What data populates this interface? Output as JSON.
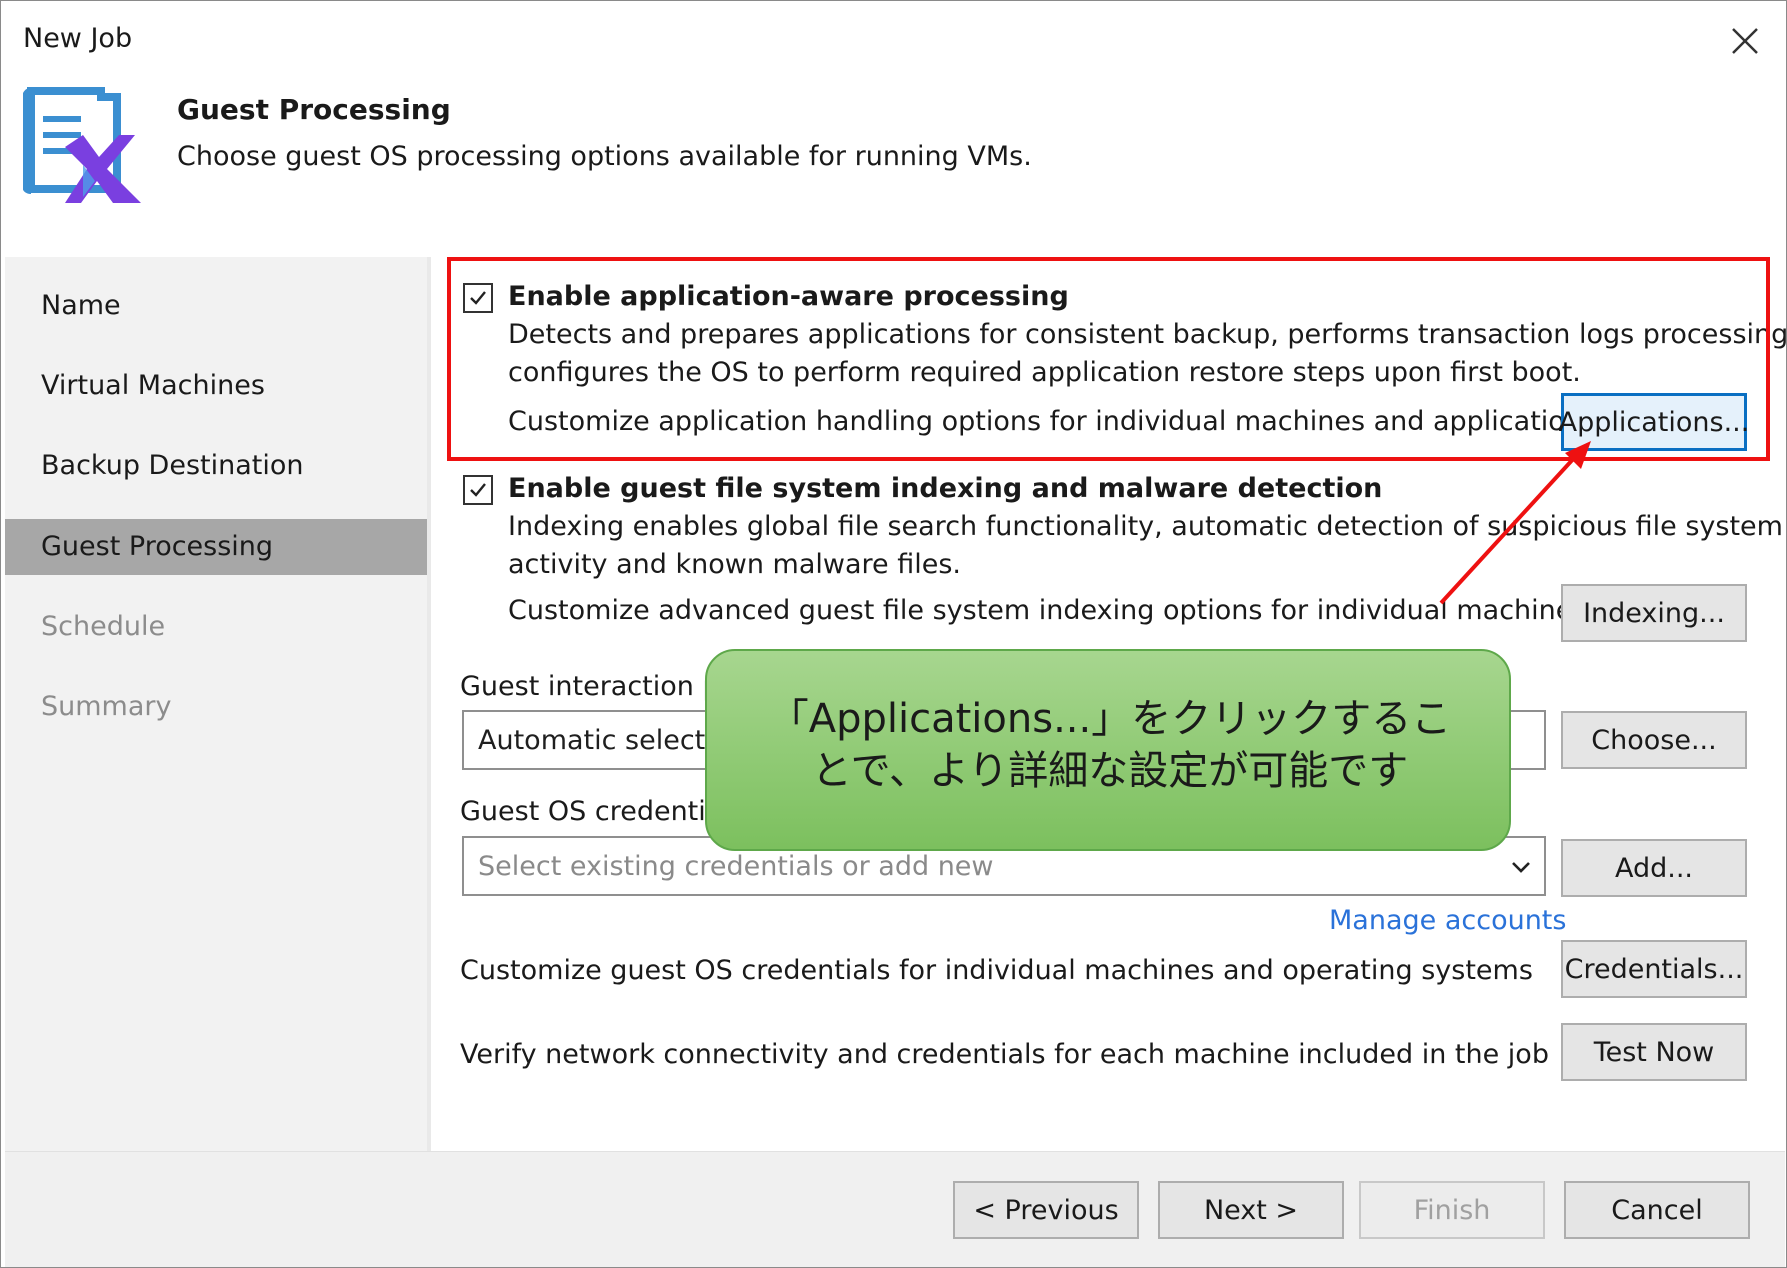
{
  "window": {
    "title": "New Job",
    "close_icon": "close-icon"
  },
  "header": {
    "title": "Guest Processing",
    "subtitle": "Choose guest OS processing options available for running VMs."
  },
  "sidebar": {
    "items": [
      {
        "label": "Name",
        "state": "normal"
      },
      {
        "label": "Virtual Machines",
        "state": "normal"
      },
      {
        "label": "Backup Destination",
        "state": "normal"
      },
      {
        "label": "Guest Processing",
        "state": "active"
      },
      {
        "label": "Schedule",
        "state": "disabled"
      },
      {
        "label": "Summary",
        "state": "disabled"
      }
    ]
  },
  "app_aware": {
    "checked": true,
    "label": "Enable application-aware processing",
    "desc_line1": "Detects and prepares applications for consistent backup, performs transaction logs processing, and",
    "desc_line2": "configures the OS to perform required application restore steps upon first boot.",
    "customize_text": "Customize application handling options for individual machines and applications",
    "button": "Applications..."
  },
  "indexing": {
    "checked": true,
    "label": "Enable guest file system indexing and malware detection",
    "desc_line1": "Indexing enables global file search functionality, automatic detection of suspicious file system",
    "desc_line2": "activity and known malware files.",
    "customize_text": "Customize advanced guest file system indexing options for individual machines",
    "button": "Indexing..."
  },
  "proxy": {
    "label": "Guest interaction pr",
    "value": "Automatic selectio",
    "button": "Choose..."
  },
  "credentials": {
    "label": "Guest OS credential",
    "placeholder": "Select existing credentials or add new",
    "add_button": "Add...",
    "manage_link": "Manage accounts",
    "customize_text": "Customize guest OS credentials for individual machines and operating systems",
    "customize_button": "Credentials..."
  },
  "verify": {
    "text": "Verify network connectivity and credentials for each machine included in the job",
    "button": "Test Now"
  },
  "footer": {
    "previous": "< Previous",
    "next": "Next >",
    "finish": "Finish",
    "cancel": "Cancel"
  },
  "annotation": {
    "callout_line1": "「Applications...」をクリックするこ",
    "callout_line2": "とで、より詳細な設定が可能です",
    "highlight_color": "#ee1111",
    "callout_color": "#8fcb73"
  }
}
